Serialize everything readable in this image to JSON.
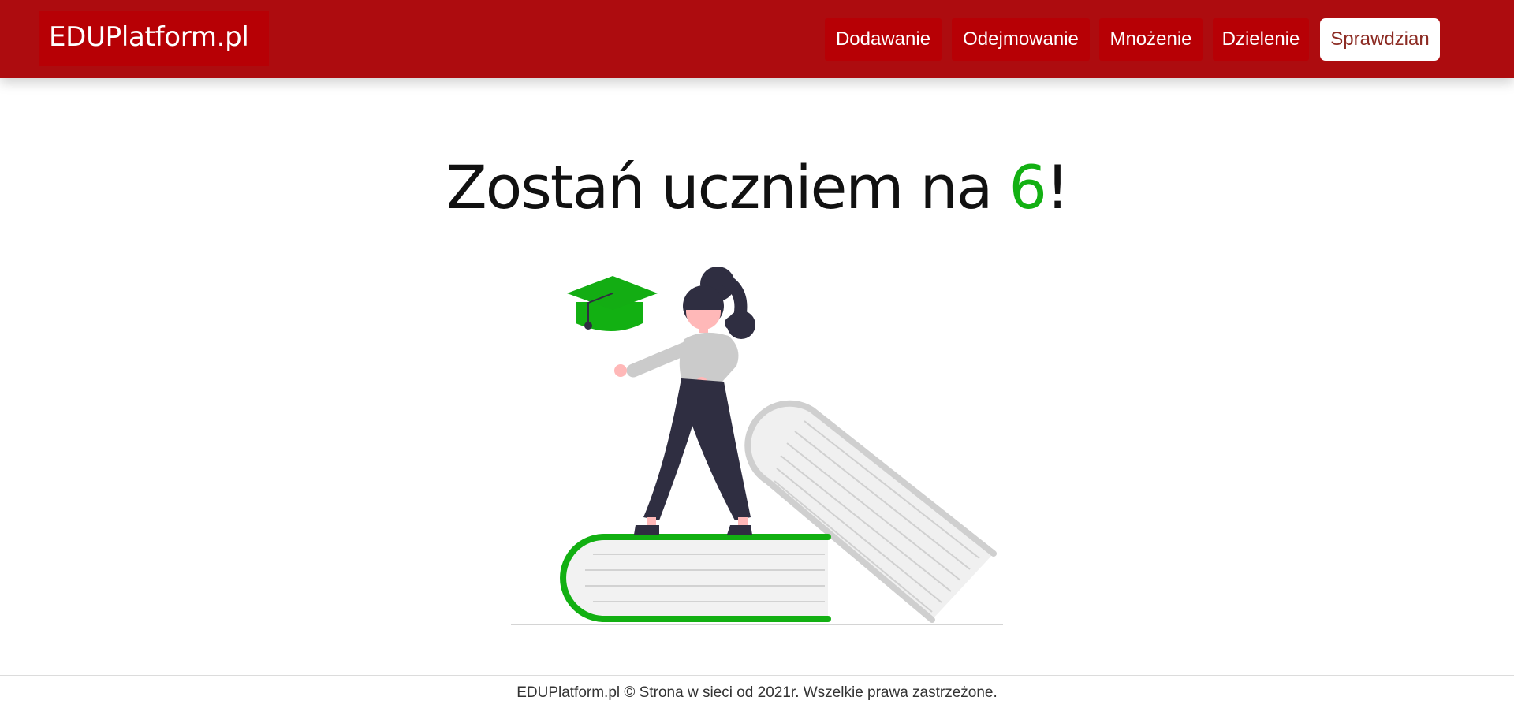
{
  "navbar": {
    "brand": "EDUPlatform.pl",
    "items": [
      {
        "label": "Dodawanie"
      },
      {
        "label": "Odejmowanie"
      },
      {
        "label": "Mnożenie"
      },
      {
        "label": "Dzielenie"
      },
      {
        "label": "Sprawdzian",
        "active": true
      }
    ]
  },
  "hero": {
    "title_prefix": "Zostań uczniem na ",
    "title_accent": "6",
    "title_suffix": "!"
  },
  "illustration": {
    "icon": "graduation-illustration"
  },
  "footer": {
    "text": "EDUPlatform.pl © Strona w sieci od 2021r. Wszelkie prawa zastrzeżone."
  },
  "colors": {
    "navbar_bg": "#ad0c0f",
    "nav_item_bg": "#b70005",
    "accent_green": "#12b012",
    "active_text": "#8c2b23"
  }
}
